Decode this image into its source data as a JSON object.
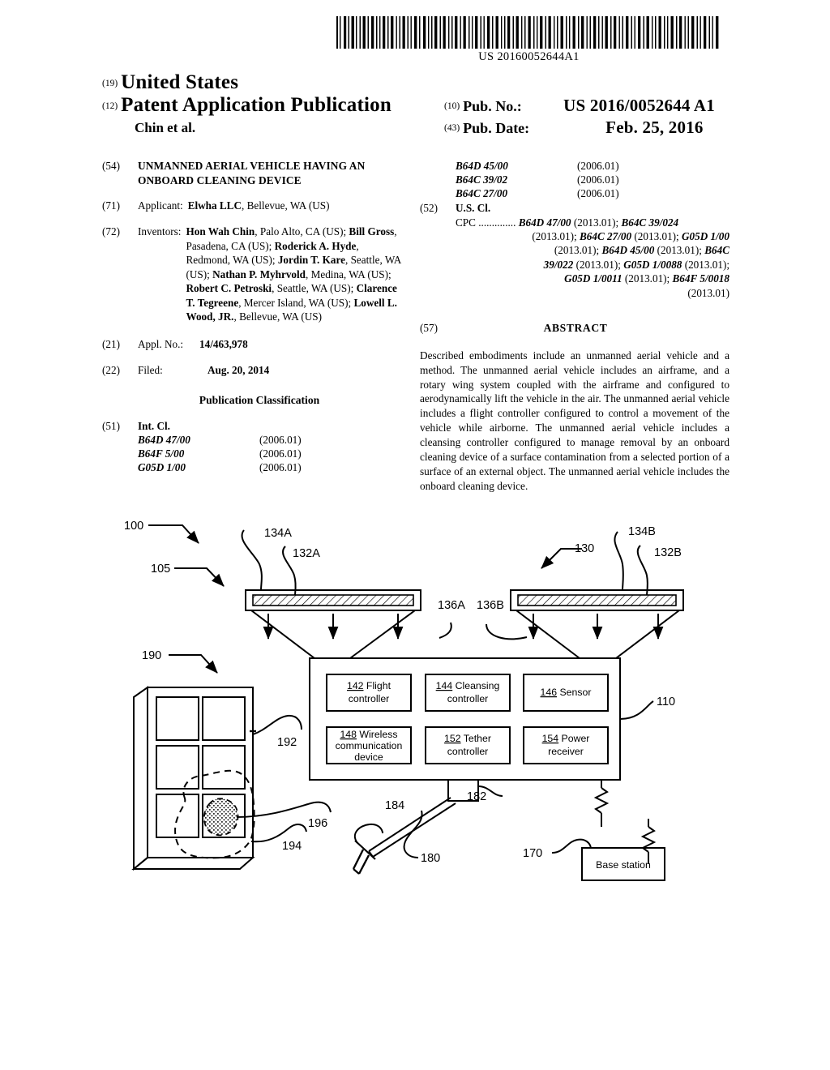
{
  "document": {
    "kind": "us-patent-application-publication",
    "barcode_text": "US 20160052644A1",
    "country_code_num": "(19)",
    "country": "United States",
    "doc_type_num": "(12)",
    "doc_type": "Patent Application Publication",
    "author_line": "Chin et al.",
    "pub_no_num": "(10)",
    "pub_no_label": "Pub. No.:",
    "pub_no_value": "US 2016/0052644 A1",
    "pub_date_num": "(43)",
    "pub_date_label": "Pub. Date:",
    "pub_date_value": "Feb. 25, 2016"
  },
  "biblio": {
    "title_code": "(54)",
    "title": "UNMANNED AERIAL VEHICLE HAVING AN ONBOARD CLEANING DEVICE",
    "applicant_code": "(71)",
    "applicant_label": "Applicant:",
    "applicant_name": "Elwha LLC",
    "applicant_address": ", Bellevue, WA (US)",
    "inventors_code": "(72)",
    "inventors_label": "Inventors:",
    "inventors": [
      {
        "name": "Hon Wah Chin",
        "address": ", Palo Alto, CA (US);"
      },
      {
        "name": "Bill Gross",
        "address": ", Pasadena, CA (US);"
      },
      {
        "name": "Roderick A. Hyde",
        "address": ", Redmond, WA (US);"
      },
      {
        "name": "Jordin T. Kare",
        "address": ", Seattle, WA (US);"
      },
      {
        "name": "Nathan P. Myhrvold",
        "address": ", Medina, WA (US);"
      },
      {
        "name": "Robert C. Petroski",
        "address": ", Seattle, WA (US);"
      },
      {
        "name": "Clarence T. Tegreene",
        "address": ", Mercer Island, WA (US);"
      },
      {
        "name": "Lowell L. Wood, JR.",
        "address": ", Bellevue, WA (US)"
      }
    ],
    "appl_no_code": "(21)",
    "appl_no_label": "Appl. No.:",
    "appl_no_value": "14/463,978",
    "filed_code": "(22)",
    "filed_label": "Filed:",
    "filed_value": "Aug. 20, 2014",
    "pub_class_heading": "Publication Classification",
    "int_cl_code": "(51)",
    "int_cl_label": "Int. Cl.",
    "int_cl_left": [
      {
        "code": "B64D 47/00",
        "date": "(2006.01)"
      },
      {
        "code": "B64F 5/00",
        "date": "(2006.01)"
      },
      {
        "code": "G05D 1/00",
        "date": "(2006.01)"
      }
    ],
    "int_cl_right": [
      {
        "code": "B64D 45/00",
        "date": "(2006.01)"
      },
      {
        "code": "B64C 39/02",
        "date": "(2006.01)"
      },
      {
        "code": "B64C 27/00",
        "date": "(2006.01)"
      }
    ],
    "us_cl_code": "(52)",
    "us_cl_label": "U.S. Cl.",
    "cpc_prefix": "CPC ..............",
    "cpc_lines": [
      {
        "bold": "B64D 47/00",
        "plain": " (2013.01); ",
        "bold2": "B64C 39/024",
        "plain2": ""
      },
      {
        "plain": "(2013.01); ",
        "bold": "B64C 27/00",
        "plain2": " (2013.01); ",
        "bold2": "G05D 1/00"
      },
      {
        "plain": "(2013.01); ",
        "bold": "B64D 45/00",
        "plain2": " (2013.01); ",
        "bold2": "B64C"
      },
      {
        "bold": "39/022",
        "plain": " (2013.01); ",
        "bold2": "G05D 1/0088",
        "plain2": " (2013.01);"
      },
      {
        "bold": "G05D 1/0011",
        "plain": " (2013.01); ",
        "bold2": "B64F 5/0018",
        "plain2": ""
      },
      {
        "plain": "(2013.01)",
        "bold": "",
        "bold2": "",
        "plain2": ""
      }
    ],
    "abstract_code": "(57)",
    "abstract_heading": "ABSTRACT",
    "abstract_text": "Described embodiments include an unmanned aerial vehicle and a method. The unmanned aerial vehicle includes an airframe, and a rotary wing system coupled with the airframe and configured to aerodynamically lift the vehicle in the air. The unmanned aerial vehicle includes a flight controller configured to control a movement of the vehicle while airborne. The unmanned aerial vehicle includes a cleansing controller configured to manage removal by an onboard cleaning device of a surface contamination from a selected portion of a surface of an external object. The unmanned aerial vehicle includes the onboard cleaning device."
  },
  "figure": {
    "reference_numerals": {
      "system": "100",
      "rotary_wing_system": "105",
      "airframe": "110",
      "rotor_assembly_right": "130",
      "rotor_blade_left": "132A",
      "rotor_blade_right": "132B",
      "rotor_housing_left": "134A",
      "rotor_housing_right": "134B",
      "airflow_left": "136A",
      "airflow_right": "136B",
      "base_station": "170",
      "tether_arm": "180",
      "tether_mount": "182",
      "cleaning_head": "184",
      "external_object": "190",
      "object_frame": "192",
      "contaminated_pane": "194",
      "surface_contamination": "196"
    },
    "component_boxes": [
      {
        "num": "142",
        "label": "Flight controller"
      },
      {
        "num": "144",
        "label": "Cleansing controller"
      },
      {
        "num": "146",
        "label": "Sensor"
      },
      {
        "num": "148",
        "label": "Wireless communication device"
      },
      {
        "num": "152",
        "label": "Tether controller"
      },
      {
        "num": "154",
        "label": "Power receiver"
      }
    ],
    "base_station_label": "Base station"
  },
  "colors": {
    "ink": "#000000",
    "paper": "#ffffff"
  }
}
